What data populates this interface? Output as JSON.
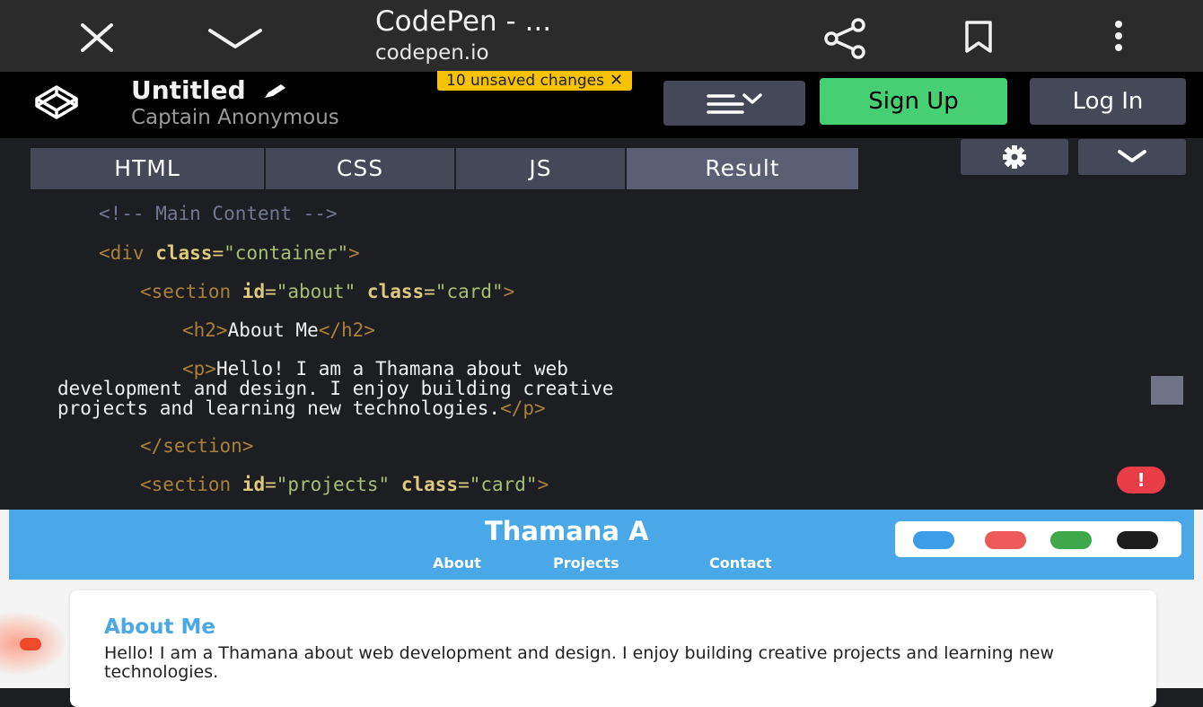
{
  "browser": {
    "title": "CodePen - ...",
    "url": "codepen.io"
  },
  "codepen": {
    "pen_title": "Untitled",
    "author": "Captain Anonymous",
    "unsaved_banner": "10 unsaved changes",
    "signup_label": "Sign Up",
    "login_label": "Log In"
  },
  "tabs": [
    {
      "label": "HTML"
    },
    {
      "label": "CSS"
    },
    {
      "label": "JS"
    },
    {
      "label": "Result"
    }
  ],
  "editor": {
    "lines": [
      {
        "comment": "<!-- Main Content -->"
      },
      {
        "open": "<div ",
        "attr1": "class",
        "eq1": "=",
        "val1": "\"container\"",
        "close": ">"
      },
      {
        "open": "<section ",
        "attr1": "id",
        "eq1": "=",
        "val1": "\"about\"",
        "attr2": "class",
        "eq2": "=",
        "val2": "\"card\"",
        "close": ">"
      },
      {
        "open": "<h2>",
        "text": "About Me",
        "close": "</h2>"
      },
      {
        "open": "<p>",
        "text1": "Hello! I am a Thamana about web",
        "text2": "development and design. I enjoy building creative",
        "text3": "projects and learning new technologies.",
        "close": "</p>"
      },
      {
        "close": "</section>"
      },
      {
        "open": "<section ",
        "attr1": "id",
        "eq1": "=",
        "val1": "\"projects\"",
        "attr2": "class",
        "eq2": "=",
        "val2": "\"card\"",
        "close": ">"
      }
    ],
    "error_badge": "!"
  },
  "preview": {
    "site_name": "Thamana A",
    "nav": [
      "About",
      "Projects",
      "Contact"
    ],
    "swatch_colors": [
      "#3d9de6",
      "#ec5a5a",
      "#3ea84a",
      "#1d1d1d"
    ],
    "card_title": "About Me",
    "card_text": "Hello! I am a Thamana about web development and design. I enjoy building creative projects and learning new technologies."
  },
  "colors": {
    "accent_blue": "#4aa8e8",
    "signup_green": "#47cf73",
    "unsaved_yellow": "#f7c300",
    "error_red": "#e83d46"
  }
}
